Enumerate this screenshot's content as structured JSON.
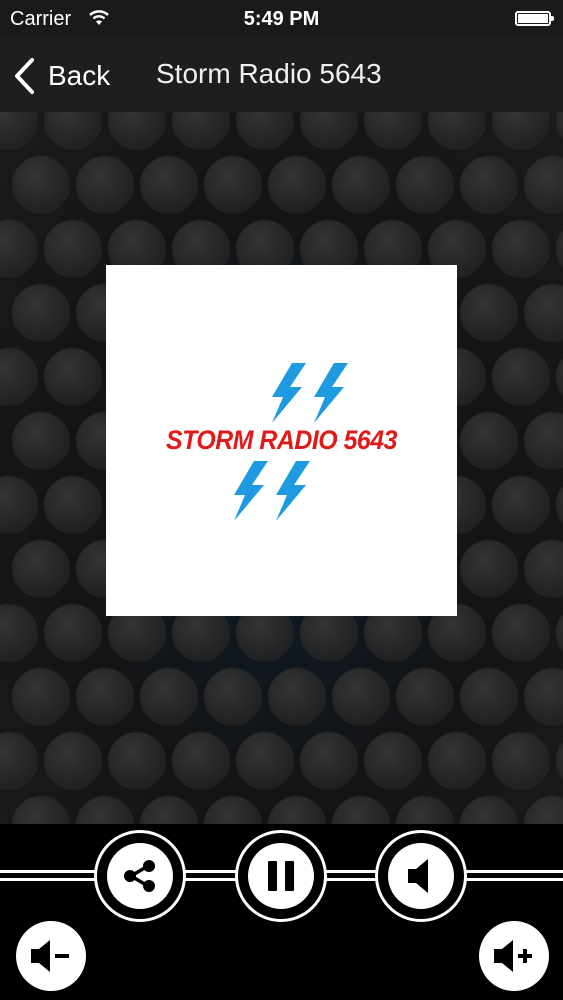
{
  "status_bar": {
    "carrier": "Carrier",
    "time": "5:49 PM"
  },
  "nav": {
    "back_label": "Back",
    "title": "Storm Radio 5643"
  },
  "artwork": {
    "logo_text": "STORM RADIO 5643",
    "logo_color": "#e01919",
    "bolt_color": "#1e9be0"
  },
  "controls": {
    "share": "share-icon",
    "pause": "pause-icon",
    "mute": "speaker-icon",
    "volume_down": "volume-down-icon",
    "volume_up": "volume-up-icon"
  }
}
